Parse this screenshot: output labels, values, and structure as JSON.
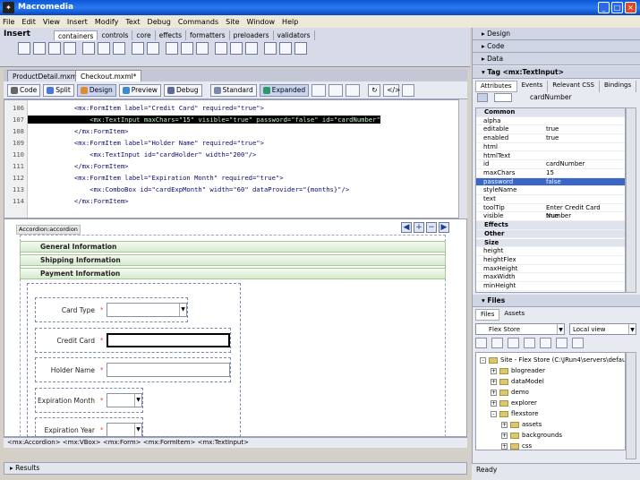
{
  "window": {
    "title": "Macromedia"
  },
  "menu": [
    "File",
    "Edit",
    "View",
    "Insert",
    "Modify",
    "Text",
    "Debug",
    "Commands",
    "Site",
    "Window",
    "Help"
  ],
  "insert": {
    "title": "Insert",
    "tabs": [
      "containers",
      "controls",
      "core",
      "effects",
      "formatters",
      "preloaders",
      "validators"
    ]
  },
  "doc_tabs": [
    "ProductDetail.mxml",
    "Checkout.mxml*"
  ],
  "doc_toolbar": {
    "code": "Code",
    "split": "Split",
    "design": "Design",
    "preview": "Preview",
    "debug": "Debug",
    "standard": "Standard",
    "expanded": "Expanded"
  },
  "code_lines": [
    {
      "n": "106",
      "t": "            <mx:FormItem label=\"Credit Card\" required=\"true\">"
    },
    {
      "n": "107",
      "t": "                <mx:TextInput maxChars=\"15\" visible=\"true\" password=\"false\" id=\"cardNumber\""
    },
    {
      "n": "108",
      "t": "            </mx:FormItem>"
    },
    {
      "n": "109",
      "t": "            <mx:FormItem label=\"Holder Name\" required=\"true\">"
    },
    {
      "n": "110",
      "t": "                <mx:TextInput id=\"cardHolder\" width=\"200\"/>"
    },
    {
      "n": "111",
      "t": "            </mx:FormItem>"
    },
    {
      "n": "112",
      "t": "            <mx:FormItem label=\"Expiration Month\" required=\"true\">"
    },
    {
      "n": "113",
      "t": "                <mx:ComboBox id=\"cardExpMonth\" width=\"60\" dataProvider=\"{months}\"/>"
    },
    {
      "n": "114",
      "t": "            </mx:FormItem>"
    }
  ],
  "design": {
    "accordion_label": "Accordion:accordion",
    "sections": [
      "General Information",
      "Shipping Information",
      "Payment Information"
    ],
    "form_labels": [
      "Card Type",
      "Credit Card",
      "Holder Name",
      "Expiration Month",
      "Expiration Year"
    ],
    "required_mark": "*"
  },
  "breadcrumb": "<mx:Accordion> <mx:VBox> <mx:Form> <mx:FormItem> <mx:TextInput>",
  "results_label": "Results",
  "right": {
    "design": "Design",
    "code": "Code",
    "data": "Data",
    "tag_title": "Tag <mx:TextInput>",
    "tag_tabs": [
      "Attributes",
      "Events",
      "Relevant CSS",
      "Bindings"
    ],
    "tag_id": "cardNumber",
    "properties": [
      {
        "cat": "Common"
      },
      {
        "n": "alpha",
        "v": ""
      },
      {
        "n": "editable",
        "v": "true"
      },
      {
        "n": "enabled",
        "v": "true"
      },
      {
        "n": "html",
        "v": ""
      },
      {
        "n": "htmlText",
        "v": ""
      },
      {
        "n": "id",
        "v": "cardNumber"
      },
      {
        "n": "maxChars",
        "v": "15"
      },
      {
        "n": "password",
        "v": "false",
        "sel": true
      },
      {
        "n": "styleName",
        "v": ""
      },
      {
        "n": "text",
        "v": ""
      },
      {
        "n": "toolTip",
        "v": "Enter Credit Card Number"
      },
      {
        "n": "visible",
        "v": "true"
      },
      {
        "cat": "Effects"
      },
      {
        "cat": "Other"
      },
      {
        "cat": "Size"
      },
      {
        "n": "height",
        "v": ""
      },
      {
        "n": "heightFlex",
        "v": ""
      },
      {
        "n": "maxHeight",
        "v": ""
      },
      {
        "n": "maxWidth",
        "v": ""
      },
      {
        "n": "minHeight",
        "v": ""
      }
    ],
    "files_title": "Files",
    "files_tabs": [
      "Files",
      "Assets"
    ],
    "site": "Flex Store",
    "view": "Local view",
    "tree": [
      {
        "name": "Site - Flex Store (C:\\JRun4\\servers\\defau",
        "lvl": 0,
        "pm": "-"
      },
      {
        "name": "blogreader",
        "lvl": 1,
        "pm": "+"
      },
      {
        "name": "dataModel",
        "lvl": 1,
        "pm": "+"
      },
      {
        "name": "demo",
        "lvl": 1,
        "pm": "+"
      },
      {
        "name": "explorer",
        "lvl": 1,
        "pm": "+"
      },
      {
        "name": "flexstore",
        "lvl": 1,
        "pm": "-"
      },
      {
        "name": "assets",
        "lvl": 2,
        "pm": "+"
      },
      {
        "name": "backgrounds",
        "lvl": 2,
        "pm": "+"
      },
      {
        "name": "css",
        "lvl": 2,
        "pm": "+"
      }
    ],
    "status": "Ready"
  }
}
